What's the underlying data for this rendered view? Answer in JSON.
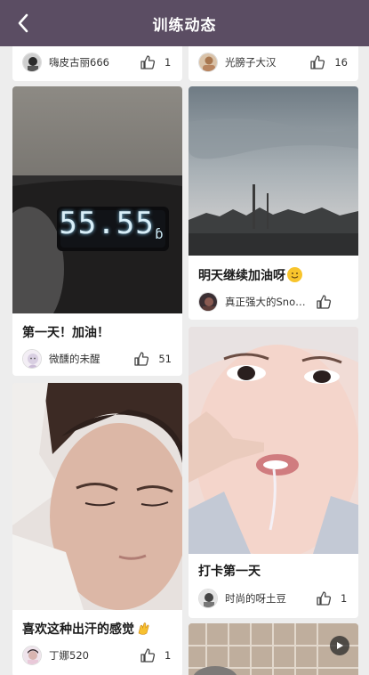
{
  "header": {
    "title": "训练动态",
    "back_icon": "chevron-left-icon",
    "bg_color": "#5b4d63"
  },
  "cards": [
    {
      "id": "c1",
      "caption": "",
      "username": "嗨皮古丽666",
      "likes": "1"
    },
    {
      "id": "c2",
      "caption": "",
      "username": "光膀子大汉",
      "likes": "16"
    },
    {
      "id": "c3",
      "caption": "第一天！加油！",
      "username": "微醺的未醒",
      "likes": "51",
      "scale_reading": "55.55"
    },
    {
      "id": "c4",
      "caption": "明天继续加油呀",
      "caption_emoji": "slightly-smiling-face-emoji",
      "username": "真正强大的Snow...",
      "likes": ""
    },
    {
      "id": "c5",
      "caption": "打卡第一天",
      "username": "时尚的呀土豆",
      "likes": "1"
    },
    {
      "id": "c6",
      "caption": "喜欢这种出汗的感觉",
      "caption_emoji": "clapping-hands-emoji",
      "username": "丁娜520",
      "likes": "1"
    },
    {
      "id": "c7",
      "caption": "",
      "username": "",
      "likes": "",
      "video": true
    }
  ]
}
